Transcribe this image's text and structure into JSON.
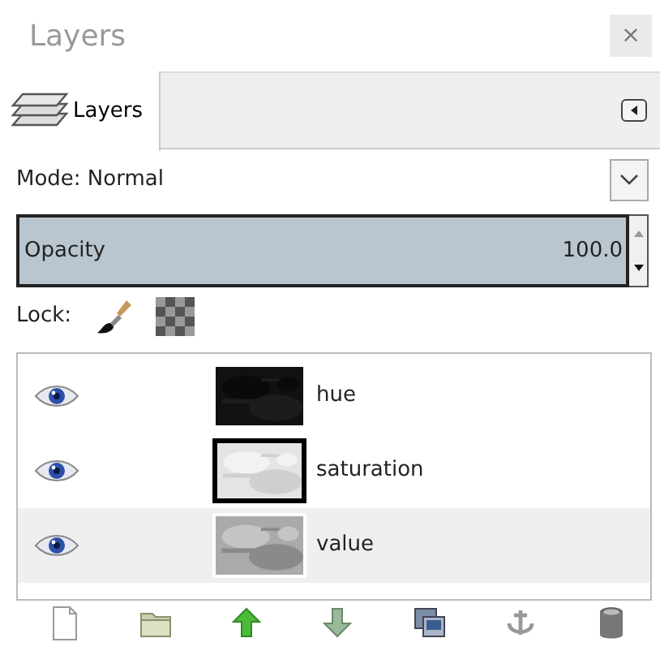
{
  "window": {
    "title": "Layers",
    "close": "×"
  },
  "tabs": [
    {
      "label": "Layers",
      "selected": true
    }
  ],
  "mode": {
    "label": "Mode: Normal"
  },
  "opacity": {
    "label": "Opacity",
    "value": "100.0",
    "level": 1.0
  },
  "lock": {
    "label": "Lock:"
  },
  "layers": [
    {
      "name": "hue",
      "visible": true,
      "selected": false,
      "thumb_framed": false
    },
    {
      "name": "saturation",
      "visible": true,
      "selected": false,
      "thumb_framed": true
    },
    {
      "name": "value",
      "visible": true,
      "selected": true,
      "thumb_framed": false
    }
  ]
}
